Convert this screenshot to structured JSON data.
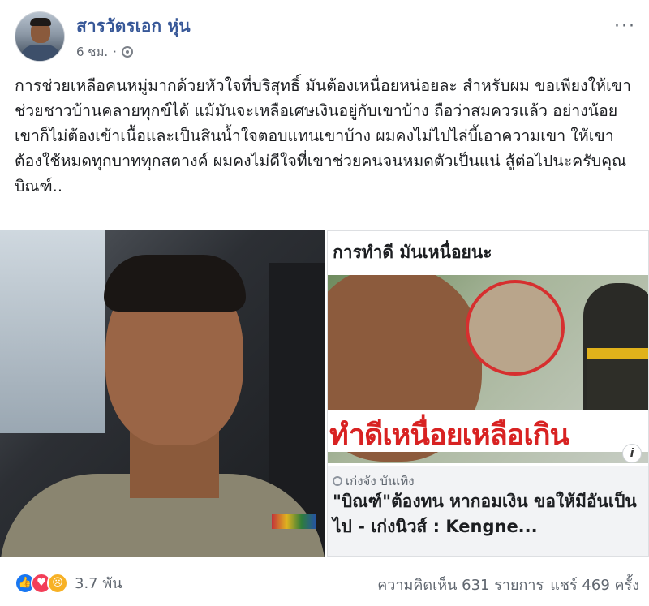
{
  "post": {
    "author": "สารวัตรเอก หุ่น",
    "time": "6 ชม.",
    "more": "···",
    "text": "การช่วยเหลือคนหมู่มากด้วยหัวใจที่บริสุทธิ์ มันต้องเหนื่อยหน่อยละ สำหรับผม ขอเพียงให้เขาช่วยชาวบ้านคลายทุกข์ได้ แม้มันจะเหลือเศษเงินอยู่กับเขาบ้าง ถือว่าสมควรแล้ว อย่างน้อยเขาก็ไม่ต้องเข้าเนื้อและเป็นสินน้ำใจตอบแทนเขาบ้าง ผมคงไม่ไปไล่บี้เอาความเขา ให้เขาต้องใช้หมดทุกบาททุกสตางค์ ผมคงไม่ดีใจที่เขาช่วยคนจนหมดตัวเป็นแน่ สู้ต่อไปนะครับคุณบิณฑ์.."
  },
  "link_card": {
    "title": "การทำดี มันเหนื่อยนะ",
    "image_headline": "ทำดีเหนื่อยเหลือเกิน",
    "info": "i",
    "source": "เก่งจัง บันเทิง",
    "headline": "\"บิณฑ์\"ต้องทน หากอมเงิน ขอให้มีอันเป็นไป - เก่งนิวส์ : Kengne..."
  },
  "footer": {
    "reaction_icons": [
      "like-icon",
      "love-icon",
      "sad-icon"
    ],
    "reaction_count": "3.7 พัน",
    "comments": "ความคิดเห็น 631 รายการ",
    "shares": "แชร์ 469 ครั้ง"
  }
}
